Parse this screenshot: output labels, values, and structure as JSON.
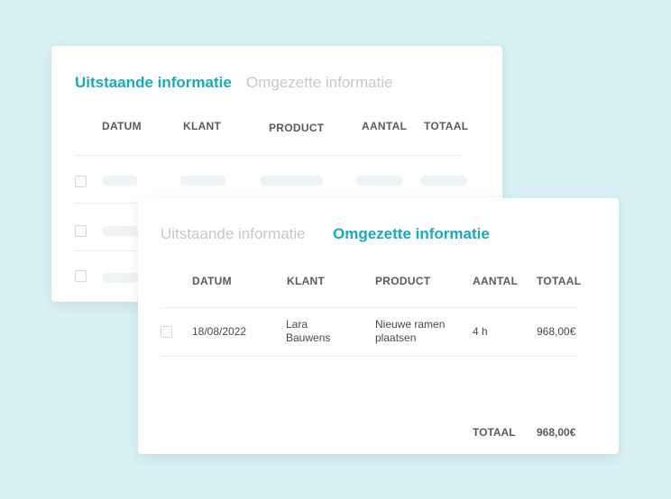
{
  "back_card": {
    "tabs": [
      {
        "label": "Uitstaande informatie",
        "active": true
      },
      {
        "label": "Omgezette informatie",
        "active": false
      }
    ],
    "columns": [
      "DATUM",
      "KLANT",
      "PRODUCT",
      "AANTAL",
      "TOTAAL"
    ]
  },
  "front_card": {
    "tabs": [
      {
        "label": "Uitstaande informatie",
        "active": false
      },
      {
        "label": "Omgezette informatie",
        "active": true
      }
    ],
    "columns": [
      "DATUM",
      "KLANT",
      "PRODUCT",
      "AANTAL",
      "TOTAAL"
    ],
    "rows": [
      {
        "datum": "18/08/2022",
        "klant": "Lara Bauwens",
        "product": "Nieuwe ramen plaatsen",
        "aantal": "4 h",
        "totaal": "968,00€"
      }
    ],
    "footer": {
      "label": "TOTAAL",
      "value": "968,00€"
    }
  },
  "colors": {
    "accent": "#19a9bc",
    "background": "#d9f1f4",
    "inactive_tab": "#c5c8cb"
  }
}
